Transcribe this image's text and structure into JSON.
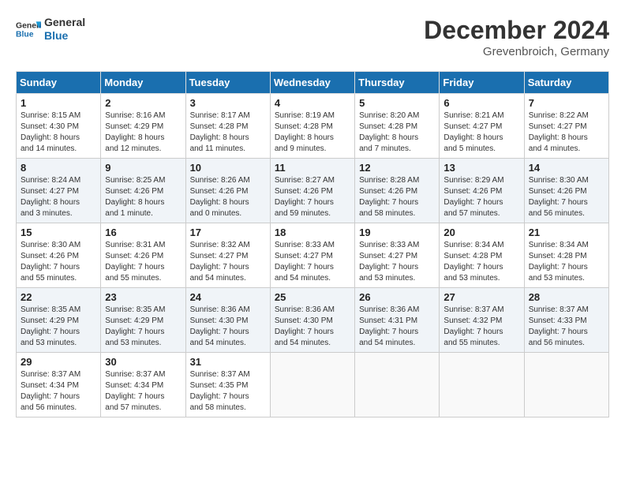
{
  "header": {
    "logo_line1": "General",
    "logo_line2": "Blue",
    "title": "December 2024",
    "subtitle": "Grevenbroich, Germany"
  },
  "calendar": {
    "headers": [
      "Sunday",
      "Monday",
      "Tuesday",
      "Wednesday",
      "Thursday",
      "Friday",
      "Saturday"
    ],
    "weeks": [
      [
        {
          "day": "1",
          "info": "Sunrise: 8:15 AM\nSunset: 4:30 PM\nDaylight: 8 hours\nand 14 minutes."
        },
        {
          "day": "2",
          "info": "Sunrise: 8:16 AM\nSunset: 4:29 PM\nDaylight: 8 hours\nand 12 minutes."
        },
        {
          "day": "3",
          "info": "Sunrise: 8:17 AM\nSunset: 4:28 PM\nDaylight: 8 hours\nand 11 minutes."
        },
        {
          "day": "4",
          "info": "Sunrise: 8:19 AM\nSunset: 4:28 PM\nDaylight: 8 hours\nand 9 minutes."
        },
        {
          "day": "5",
          "info": "Sunrise: 8:20 AM\nSunset: 4:28 PM\nDaylight: 8 hours\nand 7 minutes."
        },
        {
          "day": "6",
          "info": "Sunrise: 8:21 AM\nSunset: 4:27 PM\nDaylight: 8 hours\nand 5 minutes."
        },
        {
          "day": "7",
          "info": "Sunrise: 8:22 AM\nSunset: 4:27 PM\nDaylight: 8 hours\nand 4 minutes."
        }
      ],
      [
        {
          "day": "8",
          "info": "Sunrise: 8:24 AM\nSunset: 4:27 PM\nDaylight: 8 hours\nand 3 minutes."
        },
        {
          "day": "9",
          "info": "Sunrise: 8:25 AM\nSunset: 4:26 PM\nDaylight: 8 hours\nand 1 minute."
        },
        {
          "day": "10",
          "info": "Sunrise: 8:26 AM\nSunset: 4:26 PM\nDaylight: 8 hours\nand 0 minutes."
        },
        {
          "day": "11",
          "info": "Sunrise: 8:27 AM\nSunset: 4:26 PM\nDaylight: 7 hours\nand 59 minutes."
        },
        {
          "day": "12",
          "info": "Sunrise: 8:28 AM\nSunset: 4:26 PM\nDaylight: 7 hours\nand 58 minutes."
        },
        {
          "day": "13",
          "info": "Sunrise: 8:29 AM\nSunset: 4:26 PM\nDaylight: 7 hours\nand 57 minutes."
        },
        {
          "day": "14",
          "info": "Sunrise: 8:30 AM\nSunset: 4:26 PM\nDaylight: 7 hours\nand 56 minutes."
        }
      ],
      [
        {
          "day": "15",
          "info": "Sunrise: 8:30 AM\nSunset: 4:26 PM\nDaylight: 7 hours\nand 55 minutes."
        },
        {
          "day": "16",
          "info": "Sunrise: 8:31 AM\nSunset: 4:26 PM\nDaylight: 7 hours\nand 55 minutes."
        },
        {
          "day": "17",
          "info": "Sunrise: 8:32 AM\nSunset: 4:27 PM\nDaylight: 7 hours\nand 54 minutes."
        },
        {
          "day": "18",
          "info": "Sunrise: 8:33 AM\nSunset: 4:27 PM\nDaylight: 7 hours\nand 54 minutes."
        },
        {
          "day": "19",
          "info": "Sunrise: 8:33 AM\nSunset: 4:27 PM\nDaylight: 7 hours\nand 53 minutes."
        },
        {
          "day": "20",
          "info": "Sunrise: 8:34 AM\nSunset: 4:28 PM\nDaylight: 7 hours\nand 53 minutes."
        },
        {
          "day": "21",
          "info": "Sunrise: 8:34 AM\nSunset: 4:28 PM\nDaylight: 7 hours\nand 53 minutes."
        }
      ],
      [
        {
          "day": "22",
          "info": "Sunrise: 8:35 AM\nSunset: 4:29 PM\nDaylight: 7 hours\nand 53 minutes."
        },
        {
          "day": "23",
          "info": "Sunrise: 8:35 AM\nSunset: 4:29 PM\nDaylight: 7 hours\nand 53 minutes."
        },
        {
          "day": "24",
          "info": "Sunrise: 8:36 AM\nSunset: 4:30 PM\nDaylight: 7 hours\nand 54 minutes."
        },
        {
          "day": "25",
          "info": "Sunrise: 8:36 AM\nSunset: 4:30 PM\nDaylight: 7 hours\nand 54 minutes."
        },
        {
          "day": "26",
          "info": "Sunrise: 8:36 AM\nSunset: 4:31 PM\nDaylight: 7 hours\nand 54 minutes."
        },
        {
          "day": "27",
          "info": "Sunrise: 8:37 AM\nSunset: 4:32 PM\nDaylight: 7 hours\nand 55 minutes."
        },
        {
          "day": "28",
          "info": "Sunrise: 8:37 AM\nSunset: 4:33 PM\nDaylight: 7 hours\nand 56 minutes."
        }
      ],
      [
        {
          "day": "29",
          "info": "Sunrise: 8:37 AM\nSunset: 4:34 PM\nDaylight: 7 hours\nand 56 minutes."
        },
        {
          "day": "30",
          "info": "Sunrise: 8:37 AM\nSunset: 4:34 PM\nDaylight: 7 hours\nand 57 minutes."
        },
        {
          "day": "31",
          "info": "Sunrise: 8:37 AM\nSunset: 4:35 PM\nDaylight: 7 hours\nand 58 minutes."
        },
        {
          "day": "",
          "info": ""
        },
        {
          "day": "",
          "info": ""
        },
        {
          "day": "",
          "info": ""
        },
        {
          "day": "",
          "info": ""
        }
      ]
    ]
  }
}
